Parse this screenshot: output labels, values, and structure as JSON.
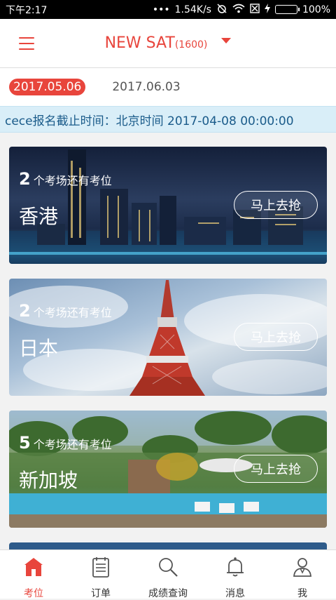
{
  "status_bar": {
    "time": "下午2:17",
    "network_speed": "1.54K/s",
    "battery": "100%",
    "battery_level": 1.0
  },
  "header": {
    "title": "NEW SAT",
    "title_sub": "(1600)"
  },
  "dates": [
    {
      "label": "2017.05.06",
      "active": true
    },
    {
      "label": "2017.06.03",
      "active": false
    }
  ],
  "deadline": "cece报名截止时间：北京时间 2017-04-08 00:00:00",
  "cards": [
    {
      "count": "2",
      "suffix": "个考场还有考位",
      "name": "香港",
      "button": "马上去抢"
    },
    {
      "count": "2",
      "suffix": "个考场还有考位",
      "name": "日本",
      "button": "马上去抢"
    },
    {
      "count": "5",
      "suffix": "个考场还有考位",
      "name": "新加坡",
      "button": "马上去抢"
    }
  ],
  "tabs": [
    {
      "label": "考位",
      "icon": "home-icon",
      "active": true
    },
    {
      "label": "订单",
      "icon": "order-icon",
      "active": false
    },
    {
      "label": "成绩查询",
      "icon": "search-icon",
      "active": false
    },
    {
      "label": "消息",
      "icon": "bell-icon",
      "active": false
    },
    {
      "label": "我",
      "icon": "person-icon",
      "active": false
    }
  ],
  "colors": {
    "accent": "#e8453c",
    "deadline_bg": "#d9eef8",
    "deadline_text": "#1a5b8a"
  }
}
